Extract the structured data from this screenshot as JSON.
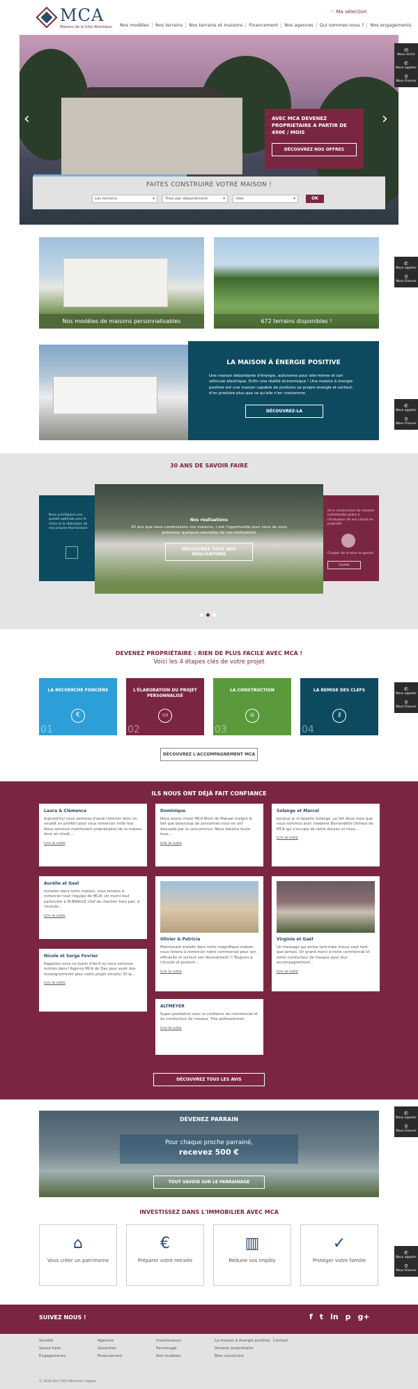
{
  "header": {
    "logo": "MCA",
    "logo_sub": "Maisons de la Côte Atlantique",
    "favorites": "Ma sélection",
    "nav": [
      "Nos modèles",
      "Nos terrains",
      "Nos terrains et maisons",
      "Financement",
      "Nos agences",
      "Qui sommes nous ?",
      "Nos engagements"
    ]
  },
  "hero": {
    "offer_text": "AVEC MCA DEVENEZ PROPRIETAIRE A PARTIR DE 490€ / MOIS",
    "offer_button": "DÉCOUVREZ NOS OFFRES",
    "slides": 5,
    "active_slide": 4
  },
  "search": {
    "title": "FAITES CONSTRUIRE VOTRE MAISON !",
    "select_1": "Les terrains",
    "select_2": "Triez par département",
    "select_3": "Ville",
    "ok": "OK"
  },
  "side": {
    "write": "Nous écrire",
    "call": "Nous appeler",
    "find": "Nous trouver"
  },
  "cards": {
    "models": "Nos modèles de maisons personnalisables",
    "lands": "672 terrains disponibles !"
  },
  "energy": {
    "title": "LA MAISON À ÉNERGIE POSITIVE",
    "text": "Une maison débordante d'énergie, autonome pour elle-même et son véhicule électrique. Enfin une réalité économique ! Une maison à énergie positive est une maison capable de produire sa propre énergie et surtout, d'en produire plus que ce qu'elle n'en consomme.",
    "button": "DÉCOUVREZ-LA"
  },
  "savoir": {
    "title": "30 ANS DE SAVOIR FAIRE",
    "slide_title": "Nos réalisations",
    "slide_text": "30 ans que nous construisons vos maisons, c'est l'opportunité pour nous de vous présenter quelques exemples de nos réalisations",
    "button": "DÉCOUVREZ TOUS NOS RÉALISATIONS",
    "left_text": "Nous privilégions une qualité optimale pour le choix et la réalisation de nos propres fournisseurs",
    "right_text": "de la construction de maisons individuelles grâce à l'évaluation de nos clients en propriété",
    "right_small": "Charger de la mise en garant",
    "right_btn": "Livres",
    "dots": 3,
    "active_dot": 2
  },
  "steps": {
    "title": "DEVENEZ PROPRIÉTAIRE : RIEN DE PLUS FACILE AVEC MCA !",
    "subtitle": "Voici les 4 étapes clés de votre projet",
    "items": [
      {
        "label": "LA RECHERCHE FONCIÈRE",
        "num": "01",
        "icon": "€",
        "color": "#2d9fd8"
      },
      {
        "label": "L'ÉLABORATION DU PROJET PERSONNALISÉ",
        "num": "02",
        "icon": "▭",
        "color": "#7b2641"
      },
      {
        "label": "LA CONSTRUCTION",
        "num": "03",
        "icon": "⌂",
        "color": "#5a9a3c"
      },
      {
        "label": "LA REMISE DES CLEFS",
        "num": "04",
        "icon": "⚷",
        "color": "#0d4a60"
      }
    ],
    "button": "DÉCOUVREZ L'ACCOMPAGNEMENT MCA"
  },
  "trust": {
    "title": "ILS NOUS ONT DÉJÀ FAIT CONFIANCE",
    "more": "Lire la suite",
    "button": "DÉCOUVREZ TOUS LES AVIS",
    "reviews": [
      {
        "name": "Laura & Clémence",
        "text": "Aujourd'hui nous sommes d'avoir internet donc on voulait en profiter pour vous remercier mille fois. Nous sommes maintenant propriétaires de la maison dont on rêvait…."
      },
      {
        "name": "Dominique",
        "text": "Nous avons choisi MCA Mont de Marsan malgré le fait que beaucoup de personnes nous en ont dissuadé par la concurrence. Nous faisions toute tous…."
      },
      {
        "name": "Solange et Marcel",
        "text": "bonjour je m'appelle Solange, ça fait deux mois que nous sommes avec madame Bernardette Dehaut de MCA qui s'occupe de notre dossier et nous…"
      },
      {
        "name": "Aurélie et Gael",
        "text": "Installés dans notre maison, nous tenions à remercier tout l'équipe de MCA! Un merci tout particulier à M.BRAULE chef de chantier hors pair, à l'écoute…"
      },
      {
        "name": "Olivier & Patricia",
        "text": "Maintenant installé dans notre magnifique maison, nous tenons à remercier notre commercial pour son efficacité et surtout son dévouement !! Toujours à l'écoute et présent…"
      },
      {
        "name": "Virginie et Gaël",
        "text": "Un message qui arrive tard mais mieux vaut tard que jamais. Un grand merci à notre commercial et notre conducteur de travaux pour leur accompagnement…"
      },
      {
        "name": "Nicole et Serge Fevrier",
        "text": "Rappelez vous ce matin d'Avril où nous sommes rentrés dans l'Agence MCA de Dax pour avoir des renseignements pour notre projet retraite. Et la…"
      },
      {
        "name": "ALTMEYER",
        "text": "Super prestation avec la confiance du commercial et du conducteur de travaux. Très professionnel."
      }
    ]
  },
  "parrain": {
    "title": "DEVENEZ PARRAIN",
    "text1": "Pour chaque proche parrainé,",
    "text2": "recevez 500 €",
    "button": "TOUT SAVOIR SUR LE PARRAINAGE"
  },
  "invest": {
    "title": "INVESTISSEZ DANS L'IMMOBILIER AVEC MCA",
    "items": [
      {
        "label": "Vous créer un patrimoine",
        "icon": "⌂"
      },
      {
        "label": "Préparer votre retraite",
        "icon": "€"
      },
      {
        "label": "Réduire vos impôts",
        "icon": "▥"
      },
      {
        "label": "Protéger votre famille",
        "icon": "✓"
      }
    ]
  },
  "follow": {
    "title": "SUIVEZ NOUS !",
    "icons": [
      "f",
      "t",
      "in",
      "p",
      "g+"
    ]
  },
  "footer": {
    "cols": [
      [
        "Société",
        "Savoir-faire",
        "Engagements"
      ],
      [
        "Agences",
        "Garanties",
        "Financement"
      ],
      [
        "Investisseurs",
        "Parrainage",
        "Nos modèles"
      ],
      [
        "La maison à énergie positive",
        "Devenir propriétaire",
        "Bien construire"
      ],
      [
        "Contact"
      ]
    ],
    "copyright": "© 2016-2017 MCA Mentions Légales"
  }
}
